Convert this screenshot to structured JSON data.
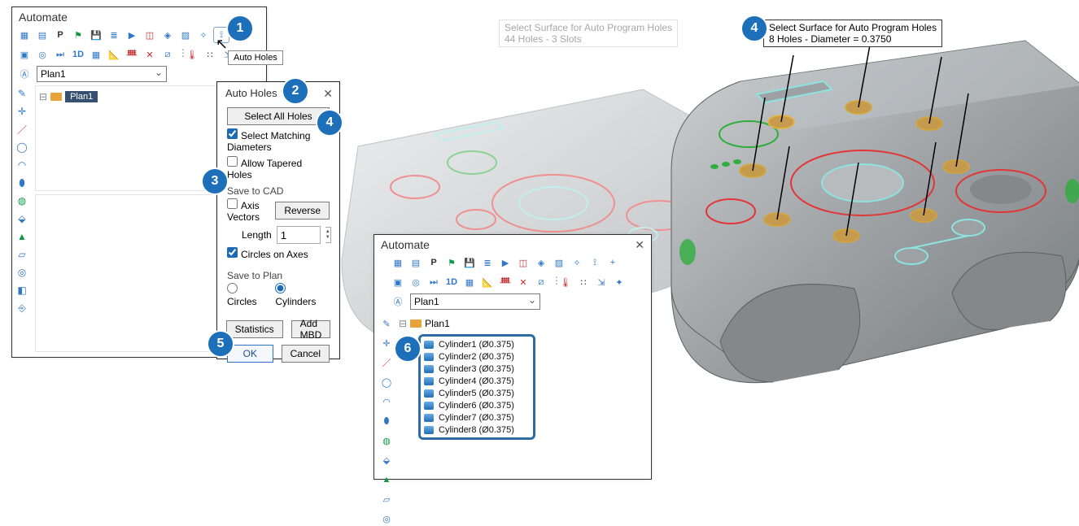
{
  "callout": {
    "n1": "1",
    "n2": "2",
    "n3": "3",
    "n4a": "4",
    "n4b": "4",
    "n5": "5",
    "n6": "6"
  },
  "automate1": {
    "title": "Automate",
    "plan_selected": "Plan1",
    "node_label": "Plan1",
    "tooltip": "Auto Holes",
    "toolbar1": [
      "form-icon",
      "doc-icon",
      "p-icon",
      "flag-icon",
      "save-icon",
      "list-icon",
      "play-icon",
      "frame-icon",
      "tag-icon",
      "hatch-icon",
      "wand-icon",
      "autoholes-icon",
      "plus-icon"
    ],
    "toolbar2": [
      "block-icon",
      "target-icon",
      "next-icon",
      "1d-icon",
      "grid-icon",
      "ruler-icon",
      "branch-icon",
      "point-icon",
      "chart-icon",
      "sep",
      "thermo-icon",
      "dots-icon",
      "cal-icon",
      "rel-icon"
    ]
  },
  "automate2": {
    "title": "Automate",
    "plan_selected": "Plan1",
    "node_label": "Plan1",
    "toolbar1": [
      "form-icon",
      "doc-icon",
      "p-icon",
      "flag-icon",
      "save-icon",
      "list-icon",
      "play-icon",
      "frame-icon",
      "tag-icon",
      "hatch-icon",
      "wand-icon",
      "autoholes-icon",
      "plus-icon"
    ],
    "toolbar2": [
      "block-icon",
      "target-icon",
      "next-icon",
      "1d-icon",
      "grid-icon",
      "ruler-icon",
      "branch-icon",
      "point-icon",
      "chart-icon",
      "sep",
      "thermo-icon",
      "dots-icon",
      "cal-icon",
      "rel-icon"
    ],
    "cylinders": [
      "Cylinder1 (Ø0.375)",
      "Cylinder2 (Ø0.375)",
      "Cylinder3 (Ø0.375)",
      "Cylinder4 (Ø0.375)",
      "Cylinder5 (Ø0.375)",
      "Cylinder6 (Ø0.375)",
      "Cylinder7 (Ø0.375)",
      "Cylinder8 (Ø0.375)"
    ]
  },
  "dlg": {
    "title": "Auto Holes",
    "select_all": "Select All Holes",
    "cb_match": "Select Matching Diameters",
    "cb_tapered": "Allow Tapered Holes",
    "grp_cad": "Save to CAD",
    "cb_axis": "Axis Vectors",
    "btn_reverse": "Reverse",
    "length_label": "Length",
    "length_value": "1",
    "cb_circles": "Circles on Axes",
    "grp_plan": "Save to Plan",
    "r_circles": "Circles",
    "r_cylinders": "Cylinders",
    "btn_stats": "Statistics",
    "btn_mbd": "Add MBD",
    "btn_ok": "OK",
    "btn_cancel": "Cancel"
  },
  "tip_left": {
    "l1": "Select Surface for Auto Program Holes",
    "l2": "44 Holes - 3 Slots"
  },
  "tip_right": {
    "l1": "Select Surface for Auto Program Holes",
    "l2": "8 Holes - Diameter = 0.3750"
  }
}
